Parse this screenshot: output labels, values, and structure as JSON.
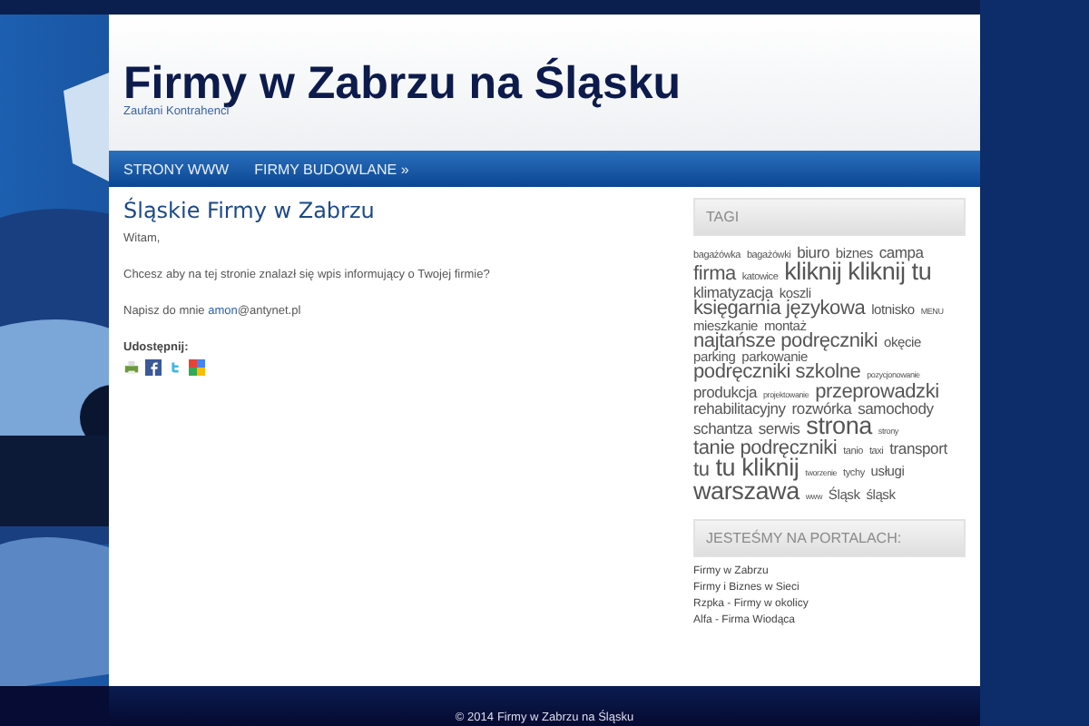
{
  "header": {
    "title": "Firmy w Zabrzu na Śląsku",
    "tagline": "Zaufani Kontrahenci"
  },
  "nav": {
    "items": [
      {
        "label": "STRONY WWW"
      },
      {
        "label": "FIRMY BUDOWLANE »"
      }
    ]
  },
  "post": {
    "title": "Śląskie Firmy w Zabrzu",
    "greeting": "Witam,",
    "question": "Chcesz aby na tej stronie znalazł się wpis informujący o Twojej firmie?",
    "contact_text": "Napisz do mnie",
    "contact_link": "amon",
    "contact_rest": "@antynet.pl",
    "share_label": "Udostępnij:",
    "share_icons": [
      {
        "kind": "print"
      },
      {
        "kind": "facebook"
      },
      {
        "kind": "twitter"
      },
      {
        "kind": "google"
      }
    ]
  },
  "sidebar": [
    {
      "kind": "tags",
      "title": "TAGI",
      "tags": [
        {
          "label": "bagażówka",
          "kind": "xs"
        },
        {
          "label": "bagażówki",
          "kind": "xs"
        },
        {
          "label": "biuro",
          "kind": "m"
        },
        {
          "label": "biznes",
          "kind": "s"
        },
        {
          "label": "campa",
          "kind": "m"
        },
        {
          "label": "firma",
          "kind": "l"
        },
        {
          "label": "katowice",
          "kind": "xs"
        },
        {
          "label": "kliknij",
          "kind": "xl"
        },
        {
          "label": "kliknij tu",
          "kind": "xl"
        },
        {
          "label": "klimatyzacja",
          "kind": "m"
        },
        {
          "label": "koszli",
          "kind": "s"
        },
        {
          "label": "księgarnia językowa",
          "kind": "l"
        },
        {
          "label": "lotnisko",
          "kind": "s"
        },
        {
          "label": "MENU",
          "kind": "xxs"
        },
        {
          "label": "mieszkanie",
          "kind": "s"
        },
        {
          "label": "montaż",
          "kind": "s"
        },
        {
          "label": "najtańsze podręczniki",
          "kind": "l"
        },
        {
          "label": "okęcie",
          "kind": "s"
        },
        {
          "label": "parking",
          "kind": "s"
        },
        {
          "label": "parkowanie",
          "kind": "s"
        },
        {
          "label": "podręczniki szkolne",
          "kind": "l"
        },
        {
          "label": "pozycjonowanie",
          "kind": "xxs"
        },
        {
          "label": "produkcja",
          "kind": "m"
        },
        {
          "label": "projektowanie",
          "kind": "xxs"
        },
        {
          "label": "przeprowadzki",
          "kind": "l"
        },
        {
          "label": "rehabilitacyjny",
          "kind": "m"
        },
        {
          "label": "rozwórka",
          "kind": "m"
        },
        {
          "label": "samochody",
          "kind": "m"
        },
        {
          "label": "schantza",
          "kind": "m"
        },
        {
          "label": "serwis",
          "kind": "m"
        },
        {
          "label": "strona",
          "kind": "xl"
        },
        {
          "label": "strony",
          "kind": "xxs"
        },
        {
          "label": "tanie podręczniki",
          "kind": "l"
        },
        {
          "label": "tanio",
          "kind": "xs"
        },
        {
          "label": "taxi",
          "kind": "xs"
        },
        {
          "label": "transport",
          "kind": "m"
        },
        {
          "label": "tu",
          "kind": "l"
        },
        {
          "label": "tu kliknij",
          "kind": "xl"
        },
        {
          "label": "tworzenie",
          "kind": "xxs"
        },
        {
          "label": "tychy",
          "kind": "xs"
        },
        {
          "label": "usługi",
          "kind": "s"
        },
        {
          "label": "warszawa",
          "kind": "xl"
        },
        {
          "label": "www",
          "kind": "xxs"
        },
        {
          "label": "Śląsk",
          "kind": "s"
        },
        {
          "label": "śląsk",
          "kind": "s"
        }
      ]
    },
    {
      "kind": "links",
      "title": "JESTEŚMY NA PORTALACH:",
      "links": [
        "Firmy w Zabrzu",
        "Firmy i Biznes w Sieci",
        "Rzpka - Firmy w okolicy",
        "Alfa - Firma Wiodąca"
      ]
    }
  ],
  "footer": {
    "copyright": "© 2014",
    "link": "Firmy w Zabrzu na Śląsku"
  }
}
